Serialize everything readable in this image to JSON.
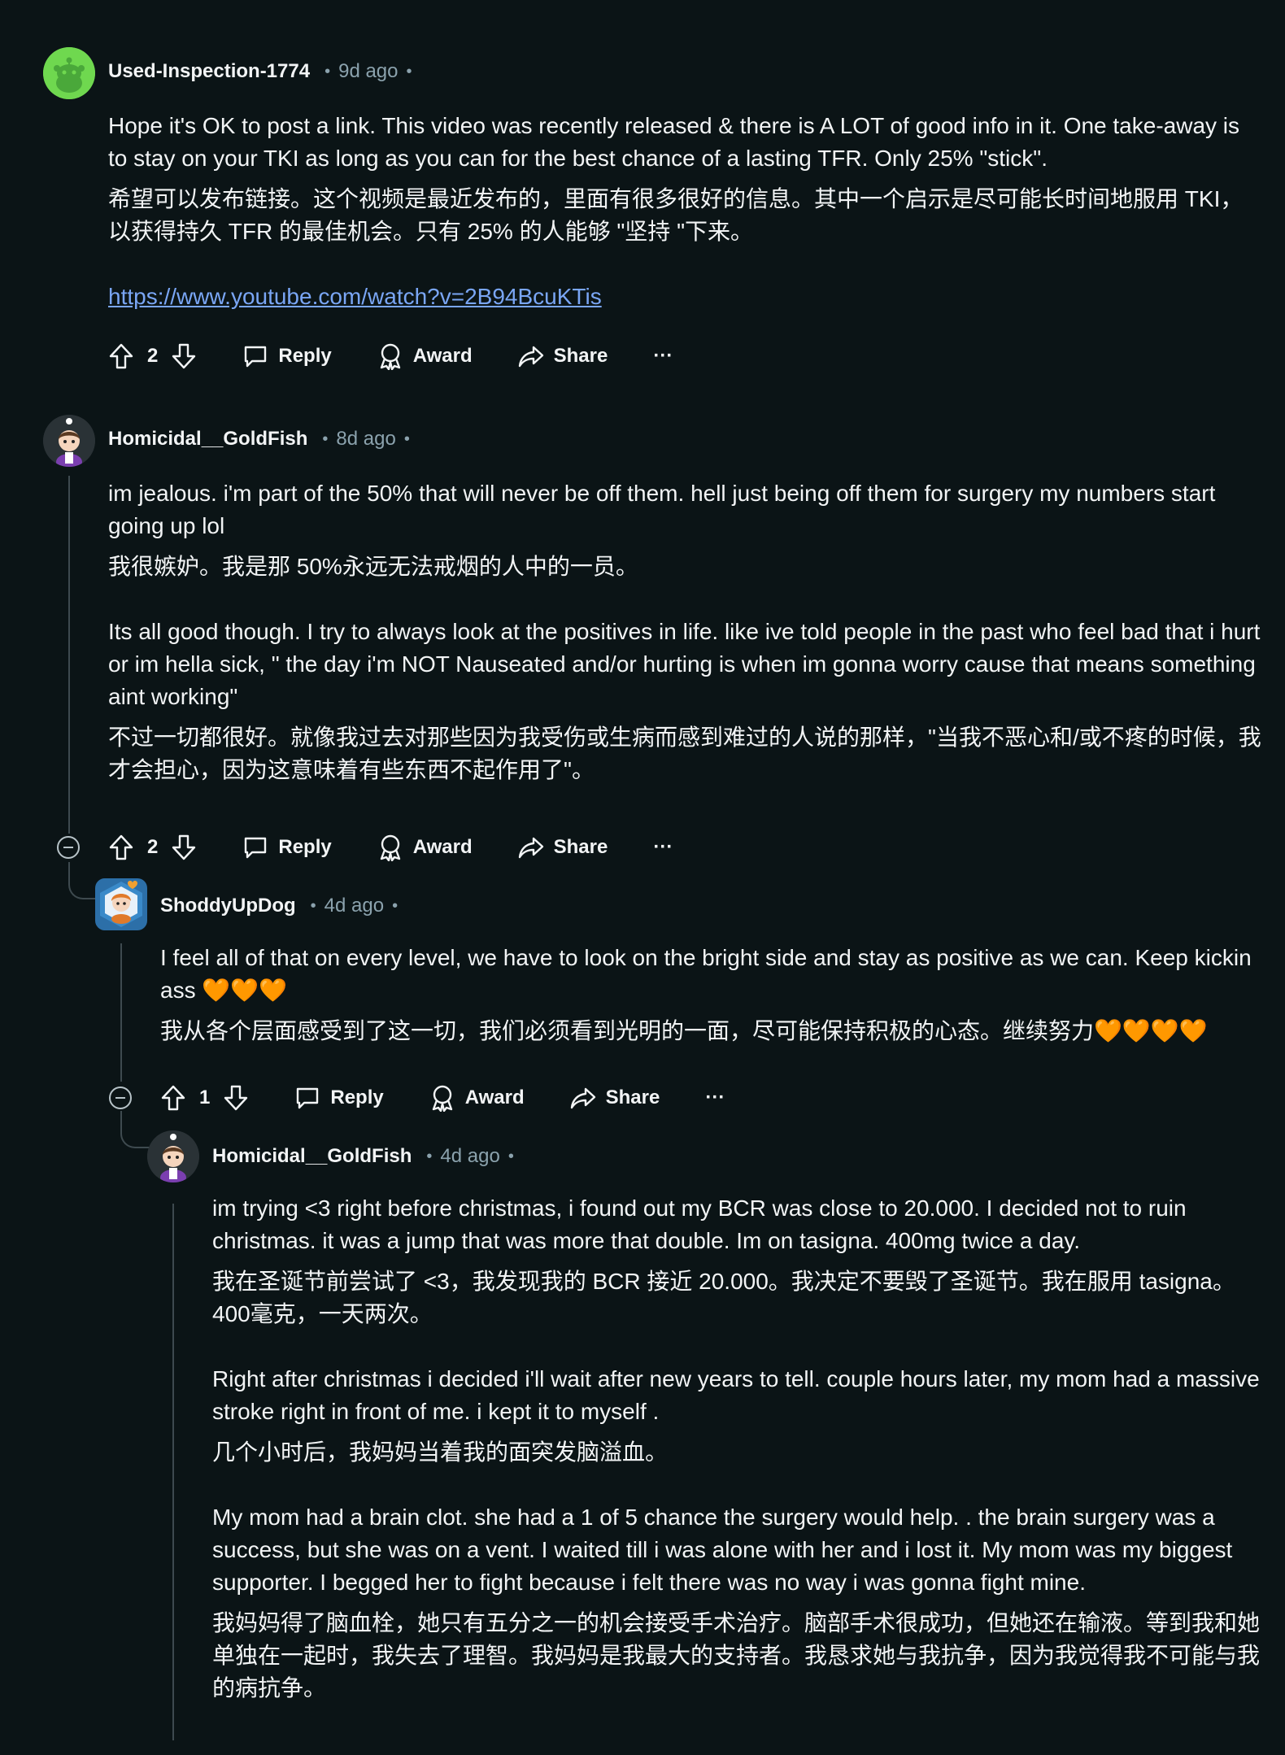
{
  "comments": [
    {
      "author": "Used-Inspection-1774",
      "time": "9d ago",
      "body_en": "Hope it's OK to post a link. This video was recently released & there is A LOT of good info in it. One take-away is to stay on your TKI as long as you can for the best chance of a lasting TFR. Only 25% \"stick\".",
      "body_zh": "希望可以发布链接。这个视频是最近发布的，里面有很多很好的信息。其中一个启示是尽可能长时间地服用 TKI，以获得持久 TFR 的最佳机会。只有 25% 的人能够 \"坚持 \"下来。",
      "link": "https://www.youtube.com/watch?v=2B94BcuKTis",
      "votes": "2",
      "reply_label": "Reply",
      "award_label": "Award",
      "share_label": "Share",
      "more_label": "···"
    },
    {
      "author": "Homicidal__GoldFish",
      "time": "8d ago",
      "body_en_1": "im jealous. i'm part of the 50% that will never be off them. hell just being off them for surgery my numbers start going up lol",
      "body_zh_1": "我很嫉妒。我是那 50%永远无法戒烟的人中的一员。",
      "body_en_2": "Its all good though. I try to always look at the positives in life. like ive told people in the past who feel bad that i hurt or im hella sick, \" the day i'm NOT Nauseated and/or hurting is when im gonna worry cause that means something aint working\"",
      "body_zh_2": "不过一切都很好。就像我过去对那些因为我受伤或生病而感到难过的人说的那样，\"当我不恶心和/或不疼的时候，我才会担心，因为这意味着有些东西不起作用了\"。",
      "votes": "2",
      "reply_label": "Reply",
      "award_label": "Award",
      "share_label": "Share",
      "more_label": "···"
    },
    {
      "author": "ShoddyUpDog",
      "time": "4d ago",
      "body_en": "I feel all of that on every level, we have to look on the bright side and stay as positive as we can. Keep kickin ass 🧡🧡🧡",
      "body_zh": "我从各个层面感受到了这一切，我们必须看到光明的一面，尽可能保持积极的心态。继续努力🧡🧡🧡🧡",
      "votes": "1",
      "reply_label": "Reply",
      "award_label": "Award",
      "share_label": "Share",
      "more_label": "···"
    },
    {
      "author": "Homicidal__GoldFish",
      "time": "4d ago",
      "body_en_1": "im trying <3 right before christmas, i found out my BCR was close to 20.000. I decided not to ruin christmas. it was a jump that was more that double. Im on tasigna. 400mg twice a day.",
      "body_zh_1": "我在圣诞节前尝试了 <3，我发现我的 BCR 接近 20.000。我决定不要毁了圣诞节。我在服用 tasigna。400毫克，一天两次。",
      "body_en_2": "Right after christmas i decided i'll wait after new years to tell. couple hours later, my mom had a massive stroke right in front of me. i kept it to myself .",
      "body_zh_2": "几个小时后，我妈妈当着我的面突发脑溢血。",
      "body_en_3": "My mom had a brain clot. she had a 1 of 5 chance the surgery would help. . the brain surgery was a success, but she was on a vent. I waited till i was alone with her and i lost it. My mom was my biggest supporter. I begged her to fight because i felt there was no way i was gonna fight mine.",
      "body_zh_3": "我妈妈得了脑血栓，她只有五分之一的机会接受手术治疗。脑部手术很成功，但她还在输液。等到我和她单独在一起时，我失去了理智。我妈妈是我最大的支持者。我恳求她与我抗争，因为我觉得我不可能与我的病抗争。"
    }
  ]
}
